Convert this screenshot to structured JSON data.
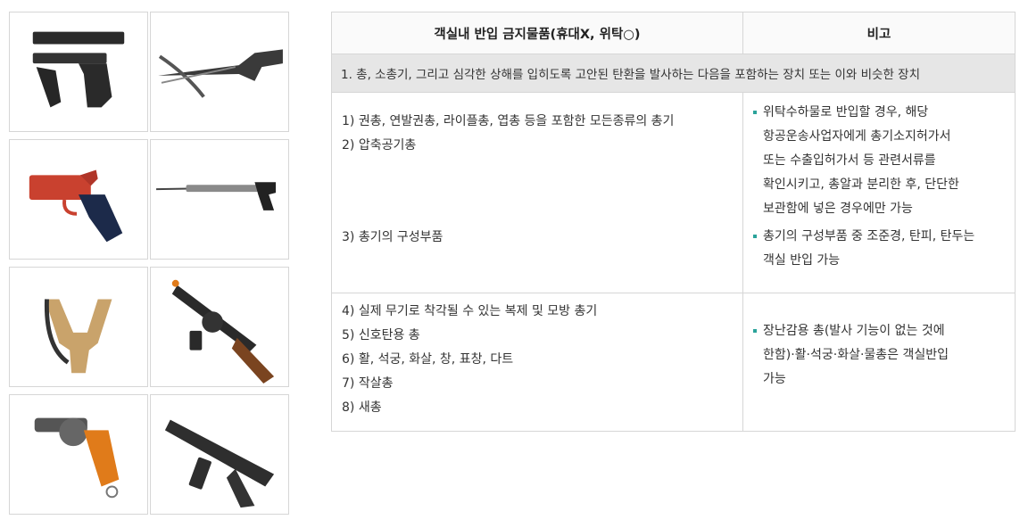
{
  "images": [
    {
      "name": "handgun-image"
    },
    {
      "name": "crossbow-image"
    },
    {
      "name": "flare-gun-image"
    },
    {
      "name": "spear-gun-image"
    },
    {
      "name": "slingshot-image"
    },
    {
      "name": "toy-submachine-gun-image"
    },
    {
      "name": "revolver-toy-image"
    },
    {
      "name": "toy-rifle-image"
    }
  ],
  "table": {
    "header": {
      "col1": "객실내 반입 금지물품(휴대X, 위탁○)",
      "col2": "비고"
    },
    "section": "1. 총, 소총기, 그리고 심각한 상해를 입히도록 고안된 탄환을 발사하는 다음을 포함하는 장치 또는 이와 비슷한 장치",
    "row2": {
      "items": [
        "1) 권총, 연발권총, 라이플총, 엽총 등을 포함한 모든종류의 총기",
        "2) 압축공기총",
        "3) 총기의 구성부품"
      ],
      "notes": [
        [
          "위탁수하물로 반입할 경우, 해당",
          "항공운송사업자에게 총기소지허가서",
          "또는 수출입허가서 등 관련서류를",
          "확인시키고, 총알과 분리한 후, 단단한",
          "보관함에 넣은 경우에만 가능"
        ],
        [
          "총기의 구성부품 중 조준경, 탄피, 탄두는",
          "객실 반입 가능"
        ]
      ]
    },
    "row3": {
      "items": [
        "4) 실제 무기로 착각될 수 있는 복제 및 모방 총기",
        "5) 신호탄용 총",
        "6) 활, 석궁, 화살, 창, 표창, 다트",
        "7) 작살총",
        "8) 새총"
      ],
      "notes": [
        [
          "장난감용 총(발사 기능이 없는 것에",
          "한함)·활·석궁·화살·물총은 객실반입",
          "가능"
        ]
      ]
    }
  },
  "colors": {
    "border": "#d6d6d6",
    "section_bg": "#e6e6e6",
    "bullet": "#2aa39a"
  }
}
